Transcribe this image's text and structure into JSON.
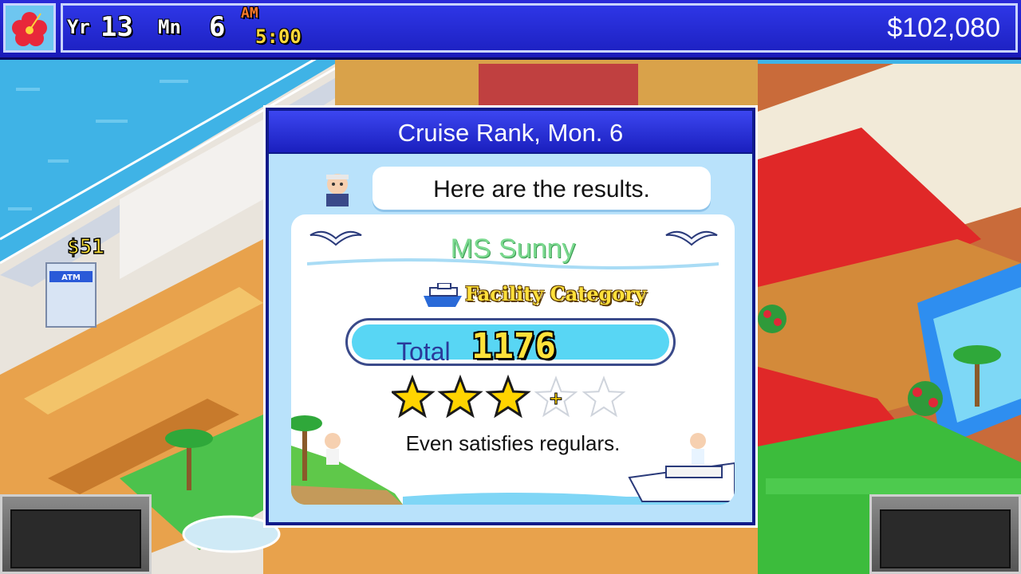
{
  "hud": {
    "year_label": "Yr",
    "year": "13",
    "month_label": "Mn",
    "month": "6",
    "ampm": "AM",
    "time": "5:00",
    "money": "$102,080"
  },
  "scene": {
    "atm_price": "$51",
    "atm_sign": "ATM"
  },
  "dialog": {
    "title": "Cruise Rank, Mon. 6",
    "speech": "Here are the results.",
    "ship_name": "MS Sunny",
    "category": "Facility Category",
    "total_label": "Total",
    "total_value": "1176",
    "rating_stars": 3.5,
    "rating_max": 5,
    "rating_text": "Even satisfies regulars."
  },
  "colors": {
    "bar_blue": "#1e22c4",
    "ocean": "#3fb3e6",
    "star_gold": "#ffd400",
    "total_bg": "#58d6f4"
  }
}
